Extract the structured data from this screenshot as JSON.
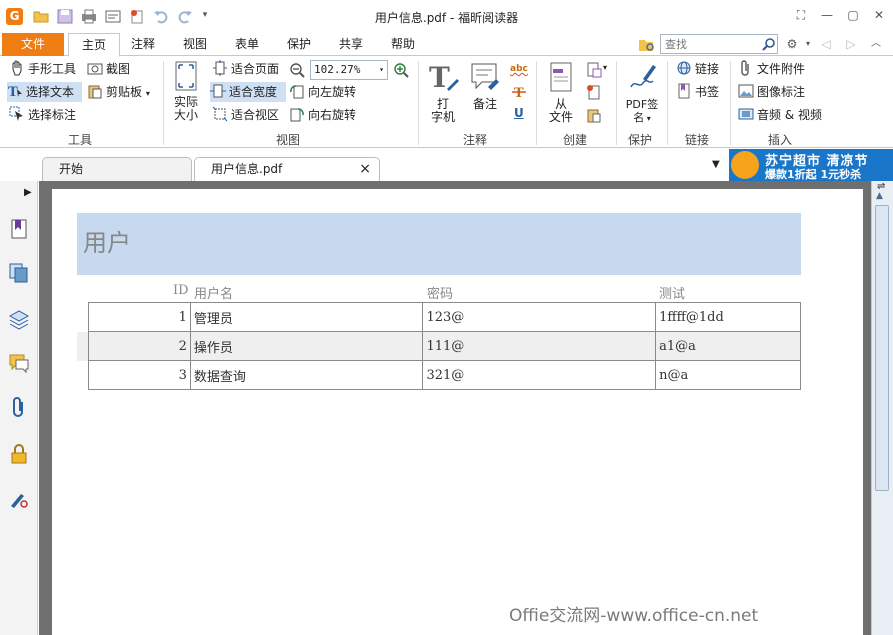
{
  "window": {
    "title": "用户信息.pdf - 福昕阅读器",
    "app_logo": "G"
  },
  "menu": {
    "file": "文件",
    "tabs": [
      "主页",
      "注释",
      "视图",
      "表单",
      "保护",
      "共享",
      "帮助"
    ],
    "active_tab": "主页",
    "search_placeholder": "查找"
  },
  "ribbon": {
    "tools": {
      "hand": "手形工具",
      "snapshot": "截图",
      "select_text": "选择文本",
      "clipboard": "剪贴板",
      "select_annotation": "选择标注",
      "group_label": "工具"
    },
    "view": {
      "actual_size_line1": "实际",
      "actual_size_line2": "大小",
      "fit_page": "适合页面",
      "fit_width": "适合宽度",
      "fit_visible": "适合视区",
      "zoom_value": "102.27%",
      "rotate_left": "向左旋转",
      "rotate_right": "向右旋转",
      "group_label": "视图"
    },
    "comment": {
      "typewriter_line1": "打",
      "typewriter_line2": "字机",
      "note": "备注",
      "abc": "abc",
      "underline": "U",
      "group_label": "注释"
    },
    "create": {
      "from_file_line1": "从",
      "from_file_line2": "文件",
      "group_label": "创建"
    },
    "protect": {
      "pdf_sign_line1": "PDF签",
      "pdf_sign_line2": "名",
      "group_label": "保护"
    },
    "links": {
      "link": "链接",
      "bookmark": "书签",
      "group_label": "链接"
    },
    "insert": {
      "file_attachment": "文件附件",
      "image_annotation": "图像标注",
      "audio_video": "音频 & 视频",
      "group_label": "插入"
    }
  },
  "doc_tabs": [
    {
      "label": "开始"
    },
    {
      "label": "用户信息.pdf",
      "close": "×"
    }
  ],
  "ad": {
    "line1": "苏宁超市 清凉节",
    "line2": "爆款1折起 1元秒杀"
  },
  "document": {
    "heading": "用户",
    "columns": [
      "ID",
      "用户名",
      "密码",
      "测试"
    ],
    "rows": [
      [
        "1",
        "管理员",
        "123@",
        "1ffff@1dd"
      ],
      [
        "2",
        "操作员",
        "111@",
        "a1@a"
      ],
      [
        "3",
        "数据查询",
        "321@",
        "n@a"
      ]
    ],
    "watermark": "Offie交流网-www.office-cn.net"
  },
  "colors": {
    "accent": "#f07d13",
    "header_band": "#c6d9ef",
    "ad_bg": "#1976c8"
  }
}
